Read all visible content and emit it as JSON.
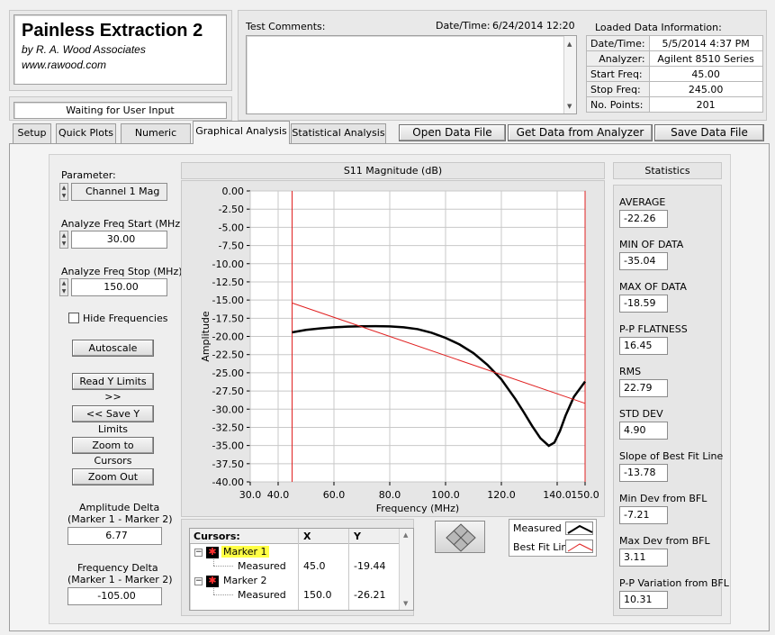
{
  "app": {
    "title": "Painless Extraction 2",
    "byline": "by R. A. Wood Associates",
    "website": "www.rawood.com",
    "status": "Waiting for User Input"
  },
  "header": {
    "comments_label": "Test Comments:",
    "datetime_label": "Date/Time:",
    "datetime_value": "6/24/2014  12:20",
    "loaded_label": "Loaded Data Information:",
    "loaded": [
      {
        "key": "Date/Time:",
        "value": "5/5/2014 4:37 PM"
      },
      {
        "key": "Analyzer:",
        "value": "Agilent 8510 Series"
      },
      {
        "key": "Start Freq:",
        "value": "45.00"
      },
      {
        "key": "Stop Freq:",
        "value": "245.00"
      },
      {
        "key": "No. Points:",
        "value": "201"
      }
    ]
  },
  "tabs": [
    "Setup",
    "Quick Plots",
    "Numeric Data",
    "Graphical Analysis",
    "Statistical Analysis"
  ],
  "active_tab": "Graphical Analysis",
  "actions": {
    "open": "Open Data File",
    "get": "Get Data from Analyzer",
    "save": "Save Data File"
  },
  "left": {
    "parameter_label": "Parameter:",
    "parameter_value": "Channel 1 Mag",
    "start_label": "Analyze Freq Start (MHz)",
    "start_value": "30.00",
    "stop_label": "Analyze Freq Stop (MHz)",
    "stop_value": "150.00",
    "hide_label": "Hide Frequencies",
    "autoscale": "Autoscale",
    "read_y": "Read Y Limits >>",
    "save_y": "<< Save Y Limits",
    "zoom_cursors": "Zoom to Cursors",
    "zoom_out": "Zoom Out",
    "amp_delta_label1": "Amplitude Delta",
    "amp_delta_label2": "(Marker 1 - Marker 2)",
    "amp_delta_value": "6.77",
    "freq_delta_label1": "Frequency Delta",
    "freq_delta_label2": "(Marker 1 - Marker 2)",
    "freq_delta_value": "-105.00"
  },
  "cursors": {
    "header": [
      "Cursors:",
      "X",
      "Y"
    ],
    "rows": [
      {
        "marker": "Marker 1",
        "trace": "Measured",
        "x": "45.0",
        "y": "-19.44"
      },
      {
        "marker": "Marker 2",
        "trace": "Measured",
        "x": "150.0",
        "y": "-26.21"
      }
    ]
  },
  "legend": [
    {
      "name": "Measured",
      "color": "#000000"
    },
    {
      "name": "Best Fit Line",
      "color": "#e02020"
    }
  ],
  "stats": {
    "title": "Statistics",
    "items": [
      {
        "label": "AVERAGE",
        "value": "-22.26"
      },
      {
        "label": "MIN OF DATA",
        "value": "-35.04"
      },
      {
        "label": "MAX OF DATA",
        "value": "-18.59"
      },
      {
        "label": "P-P FLATNESS",
        "value": "16.45"
      },
      {
        "label": "RMS",
        "value": "22.79"
      },
      {
        "label": "STD DEV",
        "value": "4.90"
      },
      {
        "label": "Slope of Best Fit Line",
        "value": "-13.78"
      },
      {
        "label": "Min Dev from BFL",
        "value": "-7.21"
      },
      {
        "label": "Max Dev from BFL",
        "value": "3.11"
      },
      {
        "label": "P-P Variation from BFL",
        "value": "10.31"
      }
    ]
  },
  "chart_data": {
    "type": "line",
    "title": "S11 Magnitude (dB)",
    "xlabel": "Frequency (MHz)",
    "ylabel": "Amplitude",
    "xlim": [
      30,
      150
    ],
    "ylim": [
      -40,
      0
    ],
    "xticks": [
      "30.0",
      "40.0",
      "60.0",
      "80.0",
      "100.0",
      "120.0",
      "140.0",
      "150.0"
    ],
    "xtick_values": [
      30,
      40,
      60,
      80,
      100,
      120,
      140,
      150
    ],
    "yticks": [
      "0.00",
      "-2.50",
      "-5.00",
      "-7.50",
      "-10.00",
      "-12.50",
      "-15.00",
      "-17.50",
      "-20.00",
      "-22.50",
      "-25.00",
      "-27.50",
      "-30.00",
      "-32.50",
      "-35.00",
      "-37.50",
      "-40.00"
    ],
    "ytick_values": [
      0,
      -2.5,
      -5,
      -7.5,
      -10,
      -12.5,
      -15,
      -17.5,
      -20,
      -22.5,
      -25,
      -27.5,
      -30,
      -32.5,
      -35,
      -37.5,
      -40
    ],
    "grid": true,
    "cursors_x": [
      45,
      150
    ],
    "series": [
      {
        "name": "Measured",
        "color": "#000000",
        "x": [
          45,
          50,
          55,
          60,
          65,
          70,
          75,
          80,
          85,
          90,
          95,
          100,
          105,
          110,
          115,
          120,
          125,
          128,
          131,
          134,
          137,
          139,
          141,
          143,
          146,
          150
        ],
        "y": [
          -19.44,
          -19.1,
          -18.9,
          -18.75,
          -18.65,
          -18.6,
          -18.59,
          -18.62,
          -18.75,
          -19.0,
          -19.5,
          -20.2,
          -21.1,
          -22.3,
          -23.9,
          -25.9,
          -28.6,
          -30.4,
          -32.3,
          -34.0,
          -35.04,
          -34.6,
          -33.0,
          -30.9,
          -28.3,
          -26.21
        ]
      },
      {
        "name": "Best Fit Line",
        "color": "#e02020",
        "x": [
          45,
          150
        ],
        "y": [
          -15.4,
          -29.2
        ]
      }
    ]
  }
}
